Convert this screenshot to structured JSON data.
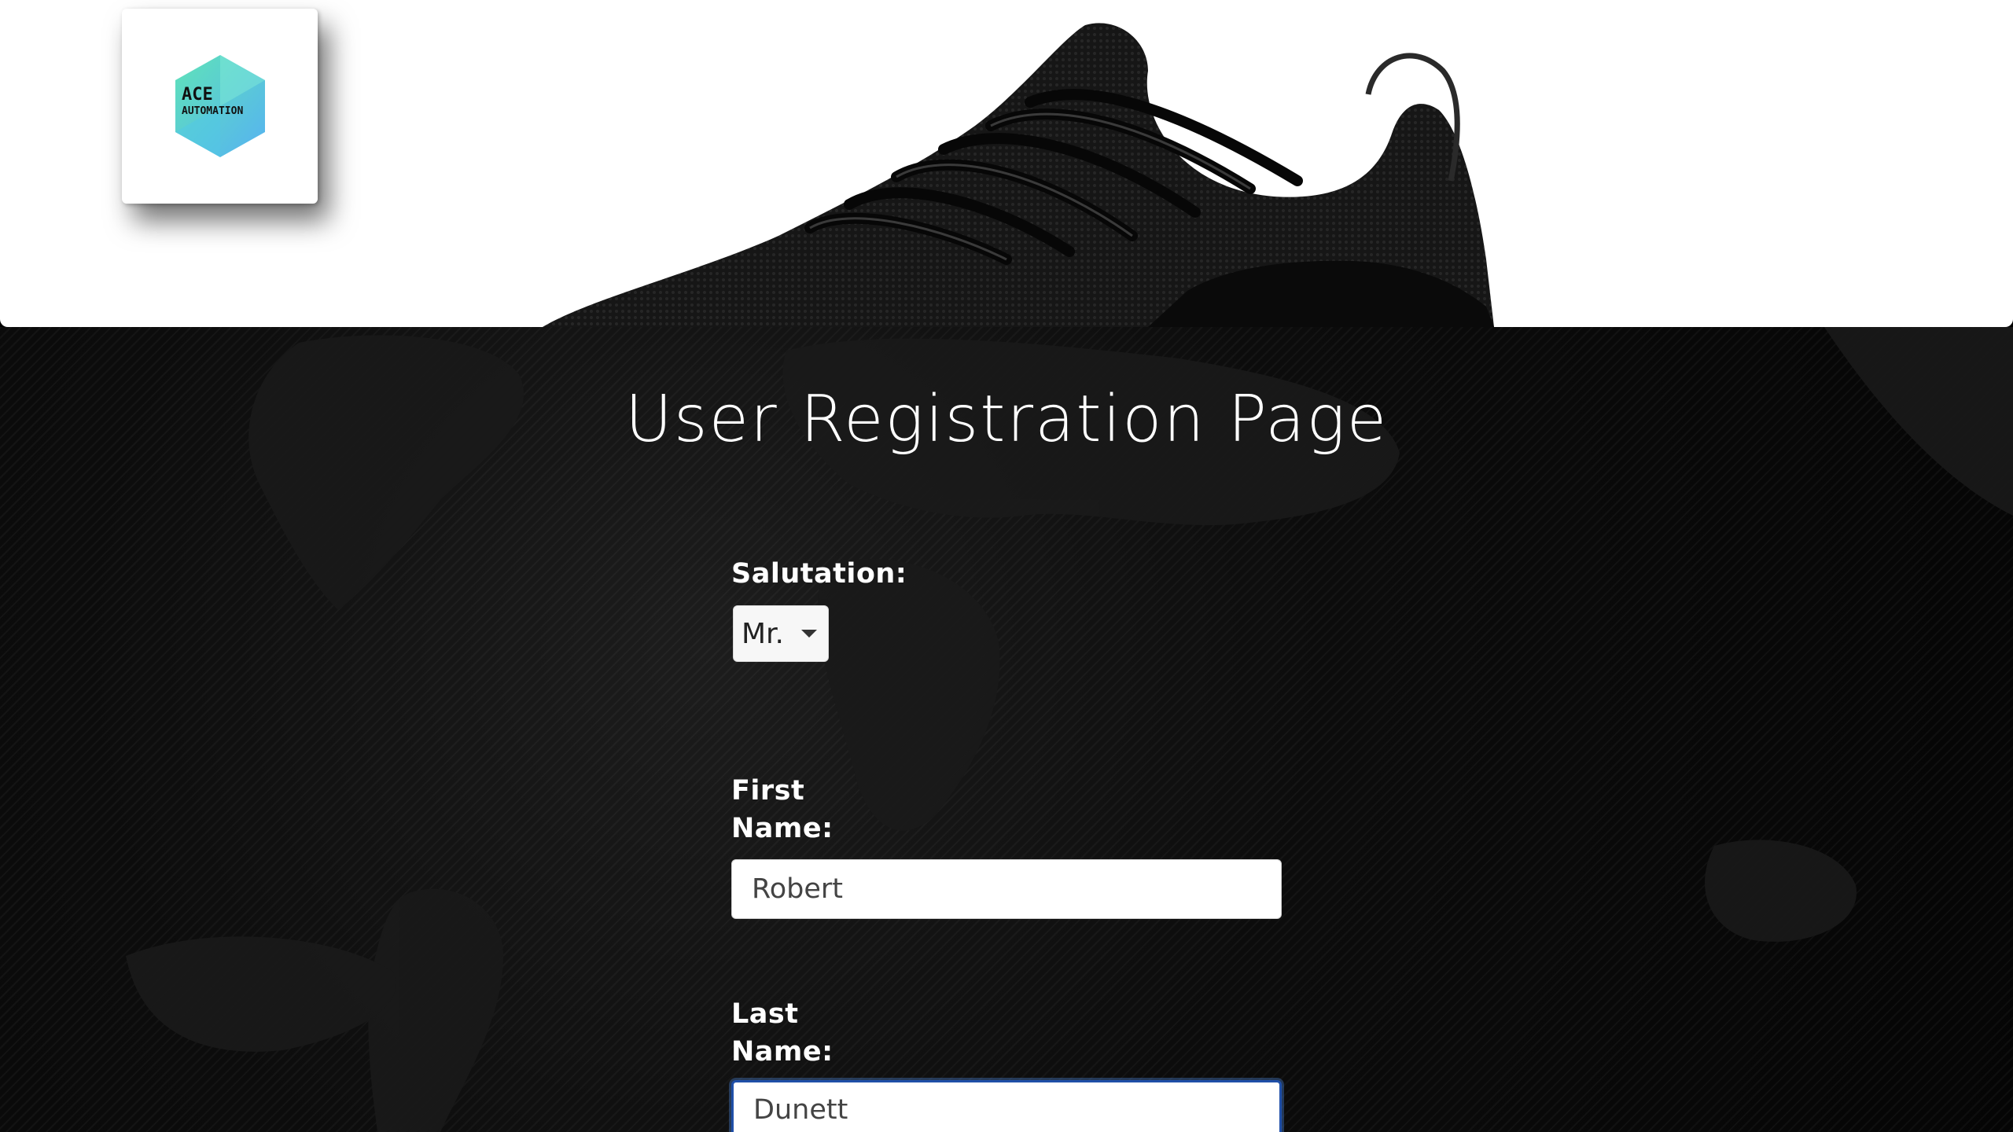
{
  "header": {
    "logo": {
      "line1": "ACE",
      "line2": "AUTOMATION"
    },
    "colors": {
      "logo_teal": "#5fe3c8",
      "logo_blue": "#56b7f0"
    }
  },
  "main": {
    "title": "User Registration Page",
    "form": {
      "salutation": {
        "label": "Salutation:",
        "selected": "Mr."
      },
      "first_name": {
        "label_line1": "First",
        "label_line2": "Name:",
        "value": "Robert"
      },
      "last_name": {
        "label_line1": "Last",
        "label_line2": "Name:",
        "value": "Dunett"
      }
    }
  },
  "colors": {
    "focus_border": "#1f4fa8",
    "background": "#0a0a0a"
  }
}
